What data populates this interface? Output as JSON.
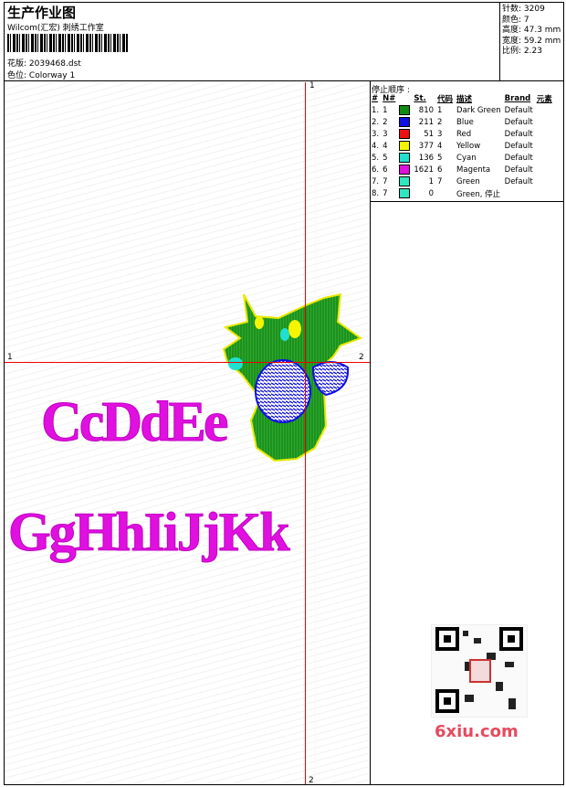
{
  "header": {
    "title": "生产作业图",
    "studio": "Wilcom(汇宏) 刺绣工作室",
    "design_label": "花版:",
    "design_file": "2039468.dst",
    "colorway_label": "色位:",
    "colorway": "Colorway 1"
  },
  "stats": {
    "stitches": "针数: 3209",
    "colors": "颜色: 7",
    "height": "高度: 47.3 mm",
    "width": "宽度: 59.2 mm",
    "ratio": "比例: 2.23"
  },
  "markers": {
    "left": "1",
    "top": "1",
    "right": "2",
    "bottom": "2"
  },
  "order": {
    "title": "停止顺序 :",
    "headers": [
      "#",
      "N#",
      "St.",
      "代码",
      "描述",
      "Brand",
      "元素"
    ],
    "rows": [
      {
        "idx": "1.",
        "n": "1",
        "color": "#118c11",
        "st": "810",
        "code": "1",
        "desc": "Dark Green",
        "brand": "Default"
      },
      {
        "idx": "2.",
        "n": "2",
        "color": "#1010e0",
        "st": "211",
        "code": "2",
        "desc": "Blue",
        "brand": "Default"
      },
      {
        "idx": "3.",
        "n": "3",
        "color": "#ee1010",
        "st": "51",
        "code": "3",
        "desc": "Red",
        "brand": "Default"
      },
      {
        "idx": "4.",
        "n": "4",
        "color": "#f5f500",
        "st": "377",
        "code": "4",
        "desc": "Yellow",
        "brand": "Default"
      },
      {
        "idx": "5.",
        "n": "5",
        "color": "#20e0d0",
        "st": "136",
        "code": "5",
        "desc": "Cyan",
        "brand": "Default"
      },
      {
        "idx": "6.",
        "n": "6",
        "color": "#e010e0",
        "st": "1621",
        "code": "6",
        "desc": "Magenta",
        "brand": "Default"
      },
      {
        "idx": "7.",
        "n": "7",
        "color": "#30e8c0",
        "st": "1",
        "code": "7",
        "desc": "Green",
        "brand": "Default"
      },
      {
        "idx": "8.",
        "n": "7",
        "color": "#30e8c0",
        "st": "0",
        "code": "",
        "desc": "Green, 停止",
        "brand": ""
      }
    ]
  },
  "artwork": {
    "line1": "CcDdEe",
    "line2": "GgHhIiJjKk"
  },
  "watermark": "6xiu.com"
}
